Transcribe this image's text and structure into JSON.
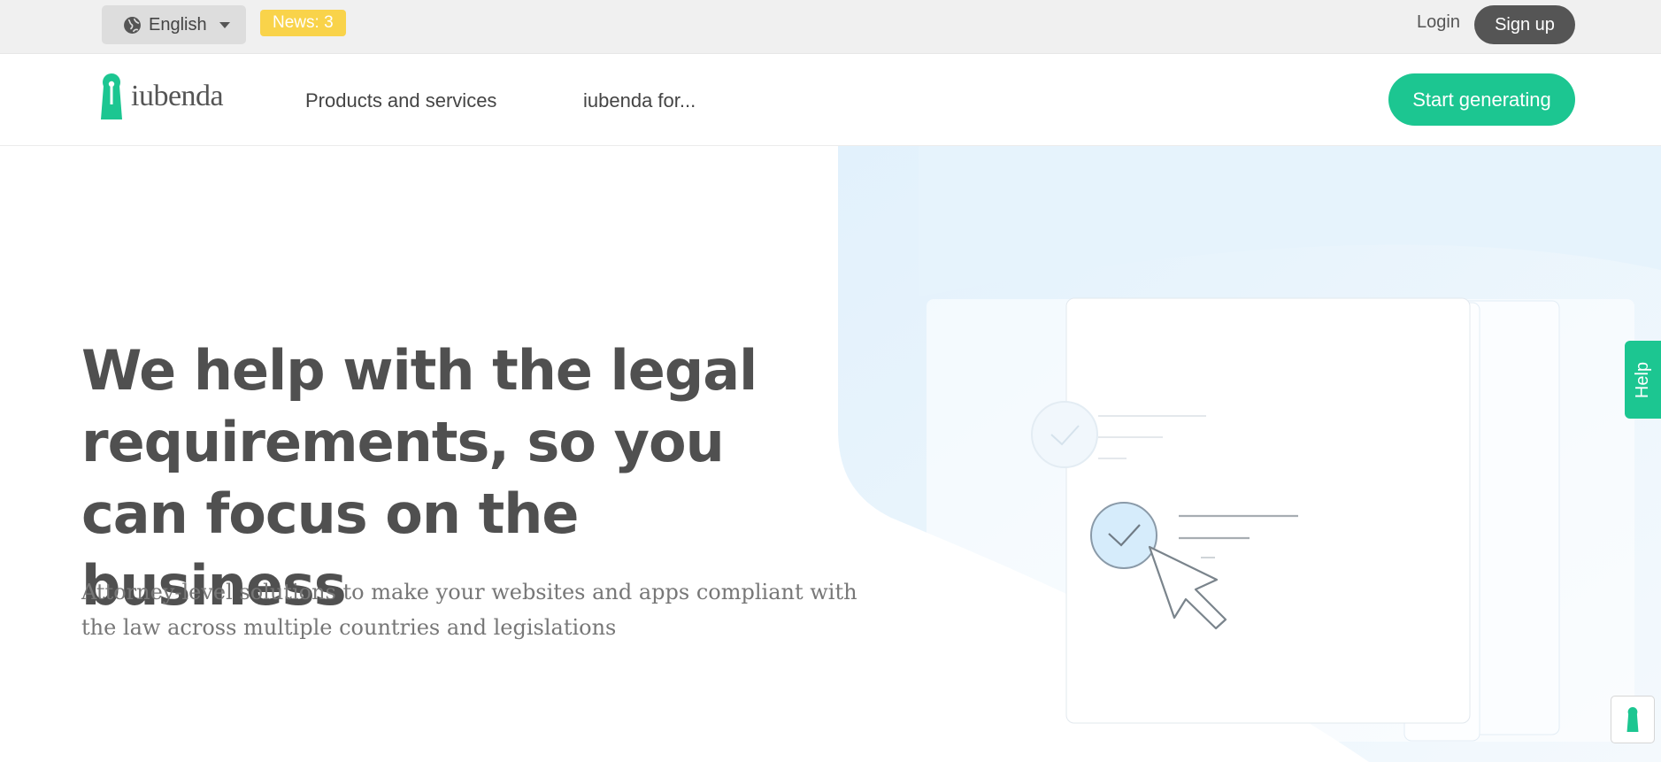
{
  "topbar": {
    "language_label": "English",
    "language_icon": "globe-icon",
    "news_label": "News: 3",
    "login_label": "Login",
    "signup_label": "Sign up"
  },
  "nav": {
    "logo_text": "iubenda",
    "items": [
      {
        "label": "Products and services"
      },
      {
        "label": "iubenda for..."
      }
    ],
    "cta_label": "Start generating"
  },
  "hero": {
    "title": "We help with the legal requirements, so you can focus on the business",
    "subtitle": "Attorney-level solutions to make your websites and apps compliant with the law across multiple countries and legislations"
  },
  "help_tab": {
    "label": "Help"
  },
  "colors": {
    "brand_green": "#1cc691",
    "news_yellow": "#f9d34a",
    "signup_dark": "#555555",
    "hero_bg_blue": "#e4f2fc"
  }
}
